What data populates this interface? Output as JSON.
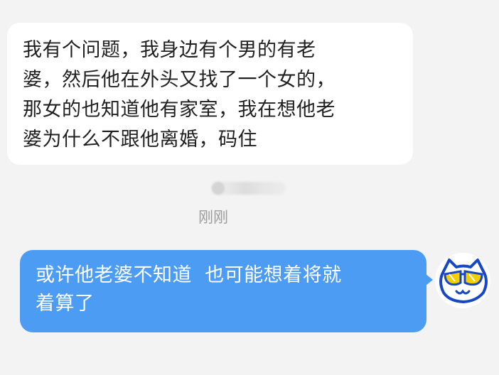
{
  "messages": {
    "incoming": {
      "text": "我有个问题，我身边有个男的有老\n婆，然后他在外头又找了一个女的，\n那女的也知道他有家室，我在想他老\n婆为什么不跟他离婚，码住"
    },
    "timestamp": "刚刚",
    "outgoing": {
      "text": "或许他老婆不知道  也可能想着将就\n着算了"
    }
  },
  "avatar": {
    "icon": "cat-with-sunglasses-icon",
    "colors": {
      "outline": "#1747c4",
      "glasses": "#f2d000"
    }
  },
  "colors": {
    "background": "#f3f3f3",
    "incoming_bubble": "#ffffff",
    "outgoing_bubble": "#4d9cf4",
    "timestamp": "#9b9b9b"
  }
}
